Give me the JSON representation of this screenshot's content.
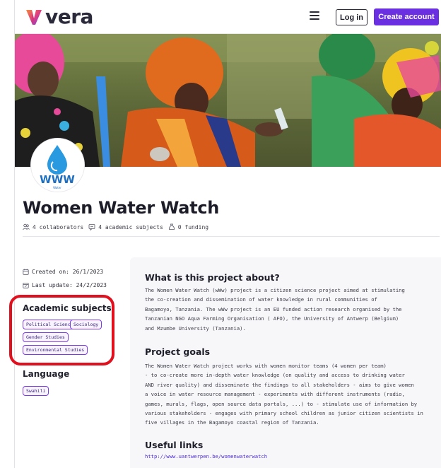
{
  "header": {
    "logo_text": "vera",
    "login_label": "Log in",
    "create_label": "Create account"
  },
  "project": {
    "title": "Women Water Watch",
    "stats": {
      "collaborators": "4 collaborators",
      "subjects": "4 academic subjects",
      "funding": "0 funding"
    },
    "created": "Created on: 26/1/2023",
    "updated": "Last update: 24/2/2023"
  },
  "sidebar": {
    "subjects_heading": "Academic subjects",
    "subjects": [
      "Political Science",
      "Sociology",
      "Gender Studies",
      "Environmental Studies"
    ],
    "language_heading": "Language",
    "languages": [
      "Swahili"
    ]
  },
  "content": {
    "about_heading": "What is this project about?",
    "about_lines": [
      "The Women Water Watch (wWw) project is a citizen science project aimed at stimulating",
      "the co-creation and dissemination of water knowledge in rural communities of",
      "Bagamoyo, Tanzania. The wWw project is an EU funded action research organised by the",
      "Tanzanian NGO Aqua Farming Organisation ( AFO), the University of Antwerp (Belgium)",
      "and Mzumbe University (Tanzania)."
    ],
    "goals_heading": "Project goals",
    "goals_lines": [
      "The Women Water Watch project works with women monitor teams (4 women per team)",
      "- to co-create more in-depth water knowledge (on quality and access to drinking water",
      "AND river quality) and disseminate the findings to all stakeholders - aims to give women",
      "a voice in water resource management - experiments with different instruments (radio,",
      "games, murals, flags, open source data portals, ...) to - stimulate use of information by",
      "various stakeholders - engages with primary school children as junior citizen scientists in",
      "five villages in the Bagamoyo coastal region of Tanzania."
    ],
    "links_heading": "Useful links",
    "link": "http://www.uantwerpen.be/womenwaterwatch"
  },
  "avatar": {
    "caption": "Water"
  },
  "colors": {
    "accent": "#6a2fe0",
    "highlight": "#e0101e",
    "link": "#4b2ad6"
  }
}
